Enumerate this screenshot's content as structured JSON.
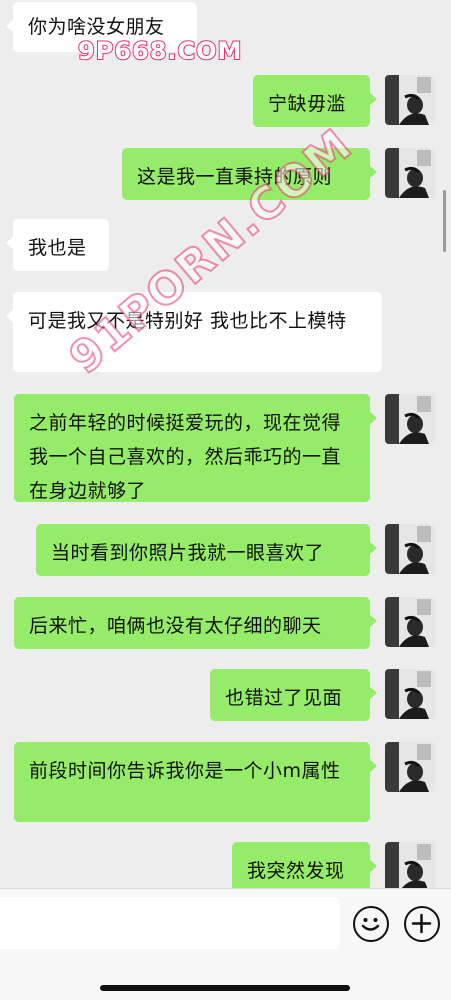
{
  "watermark": {
    "top": "9P668.COM",
    "diagonal": "91PORN.COM"
  },
  "messages": [
    {
      "side": "in",
      "text": "你为啥没女朋友"
    },
    {
      "side": "out",
      "text": "宁缺毋滥"
    },
    {
      "side": "out",
      "text": "这是我一直秉持的原则"
    },
    {
      "side": "in",
      "text": "我也是"
    },
    {
      "side": "in",
      "text": "可是我又不是特别好 我也比不上模特"
    },
    {
      "side": "out",
      "text": "之前年轻的时候挺爱玩的，现在觉得我一个自己喜欢的，然后乖巧的一直在身边就够了"
    },
    {
      "side": "out",
      "text": "当时看到你照片我就一眼喜欢了"
    },
    {
      "side": "out",
      "text": "后来忙，咱俩也没有太仔细的聊天"
    },
    {
      "side": "out",
      "text": "也错过了见面"
    },
    {
      "side": "out",
      "text": "前段时间你告诉我你是一个小m属性"
    },
    {
      "side": "out",
      "text": "我突然发现"
    }
  ],
  "input": {
    "value": "",
    "emoji_icon": "smiley-face-icon",
    "plus_icon": "plus-circle-icon"
  },
  "colors": {
    "background": "#ededed",
    "incoming_bubble": "#ffffff",
    "outgoing_bubble": "#95ec69"
  }
}
